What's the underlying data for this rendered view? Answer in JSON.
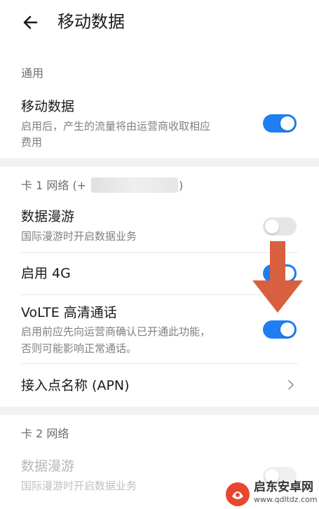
{
  "header": {
    "title": "移动数据",
    "back_icon": "arrow-left-icon"
  },
  "sections": {
    "general": {
      "label": "通用"
    },
    "card1": {
      "label_prefix": "卡 1 网络 (+",
      "label_suffix": ")"
    },
    "card2": {
      "label": "卡 2 网络"
    }
  },
  "items": {
    "mobile_data": {
      "title": "移动数据",
      "subtitle_line1": "启用后，产生的流量将由运营商收取相应",
      "subtitle_line2": "费用",
      "state": "on"
    },
    "roaming": {
      "title": "数据漫游",
      "subtitle": "国际漫游时开启数据业务",
      "state": "off"
    },
    "enable_4g": {
      "title": "启用 4G",
      "state": "on"
    },
    "volte": {
      "title": "VoLTE 高清通话",
      "subtitle_line1": "启用前应先向运营商确认已开通此功能，",
      "subtitle_line2": "否则可能影响正常通话。",
      "state": "on"
    },
    "apn": {
      "title": "接入点名称 (APN)"
    },
    "roaming2": {
      "title": "数据漫游",
      "subtitle": "国际漫游时开启数据业务",
      "state": "off",
      "disabled": true
    }
  },
  "watermark": {
    "name": "启东安卓网",
    "url": "www.qdltdz.com"
  },
  "colors": {
    "accent": "#1e7ef2",
    "arrow": "#d9603f"
  }
}
